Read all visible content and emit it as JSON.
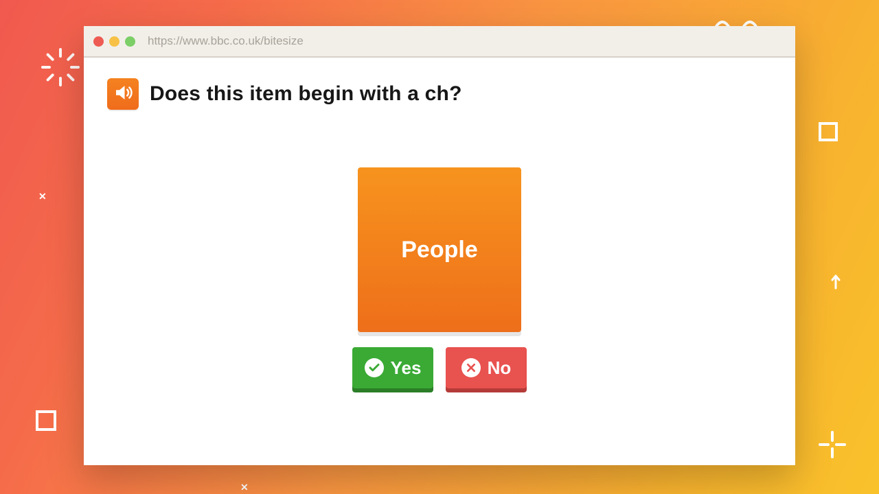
{
  "browser": {
    "url": "https://www.bbc.co.uk/bitesize"
  },
  "quiz": {
    "question": "Does this item begin with a ch?",
    "card_label": "People",
    "yes_label": "Yes",
    "no_label": "No"
  }
}
